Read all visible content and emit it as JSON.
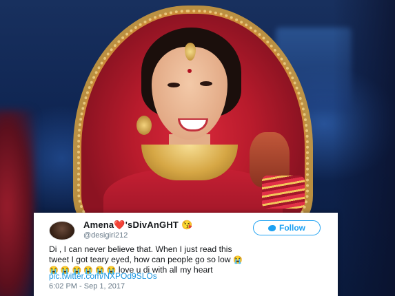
{
  "tweet": {
    "display_name": "Amena",
    "heart": "❤️",
    "name_suffix": "'sDivAnGHT",
    "name_emoji": "😘",
    "handle": "@desigiri212",
    "follow_label": "Follow",
    "text_line_1": "Di , I can never believe that. When I just read this",
    "text_line_2": "tweet I got teary eyed, how can people go so low",
    "cry_emoji": "😭",
    "cry_row": "😭 😭 😭 😭 😭 😭",
    "text_line_3": "love u di with all my heart",
    "link": "pic.twitter.com/NXPOd9SLOs",
    "timestamp": "6:02 PM - Sep 1, 2017"
  },
  "colors": {
    "follow_blue": "#1da1f2",
    "link_blue": "#1b95e0",
    "bg_navy": "#0c1a3a",
    "bridal_red": "#c51f33"
  },
  "icons": {
    "follow": "twitter-bird-icon",
    "avatar": "user-avatar"
  }
}
